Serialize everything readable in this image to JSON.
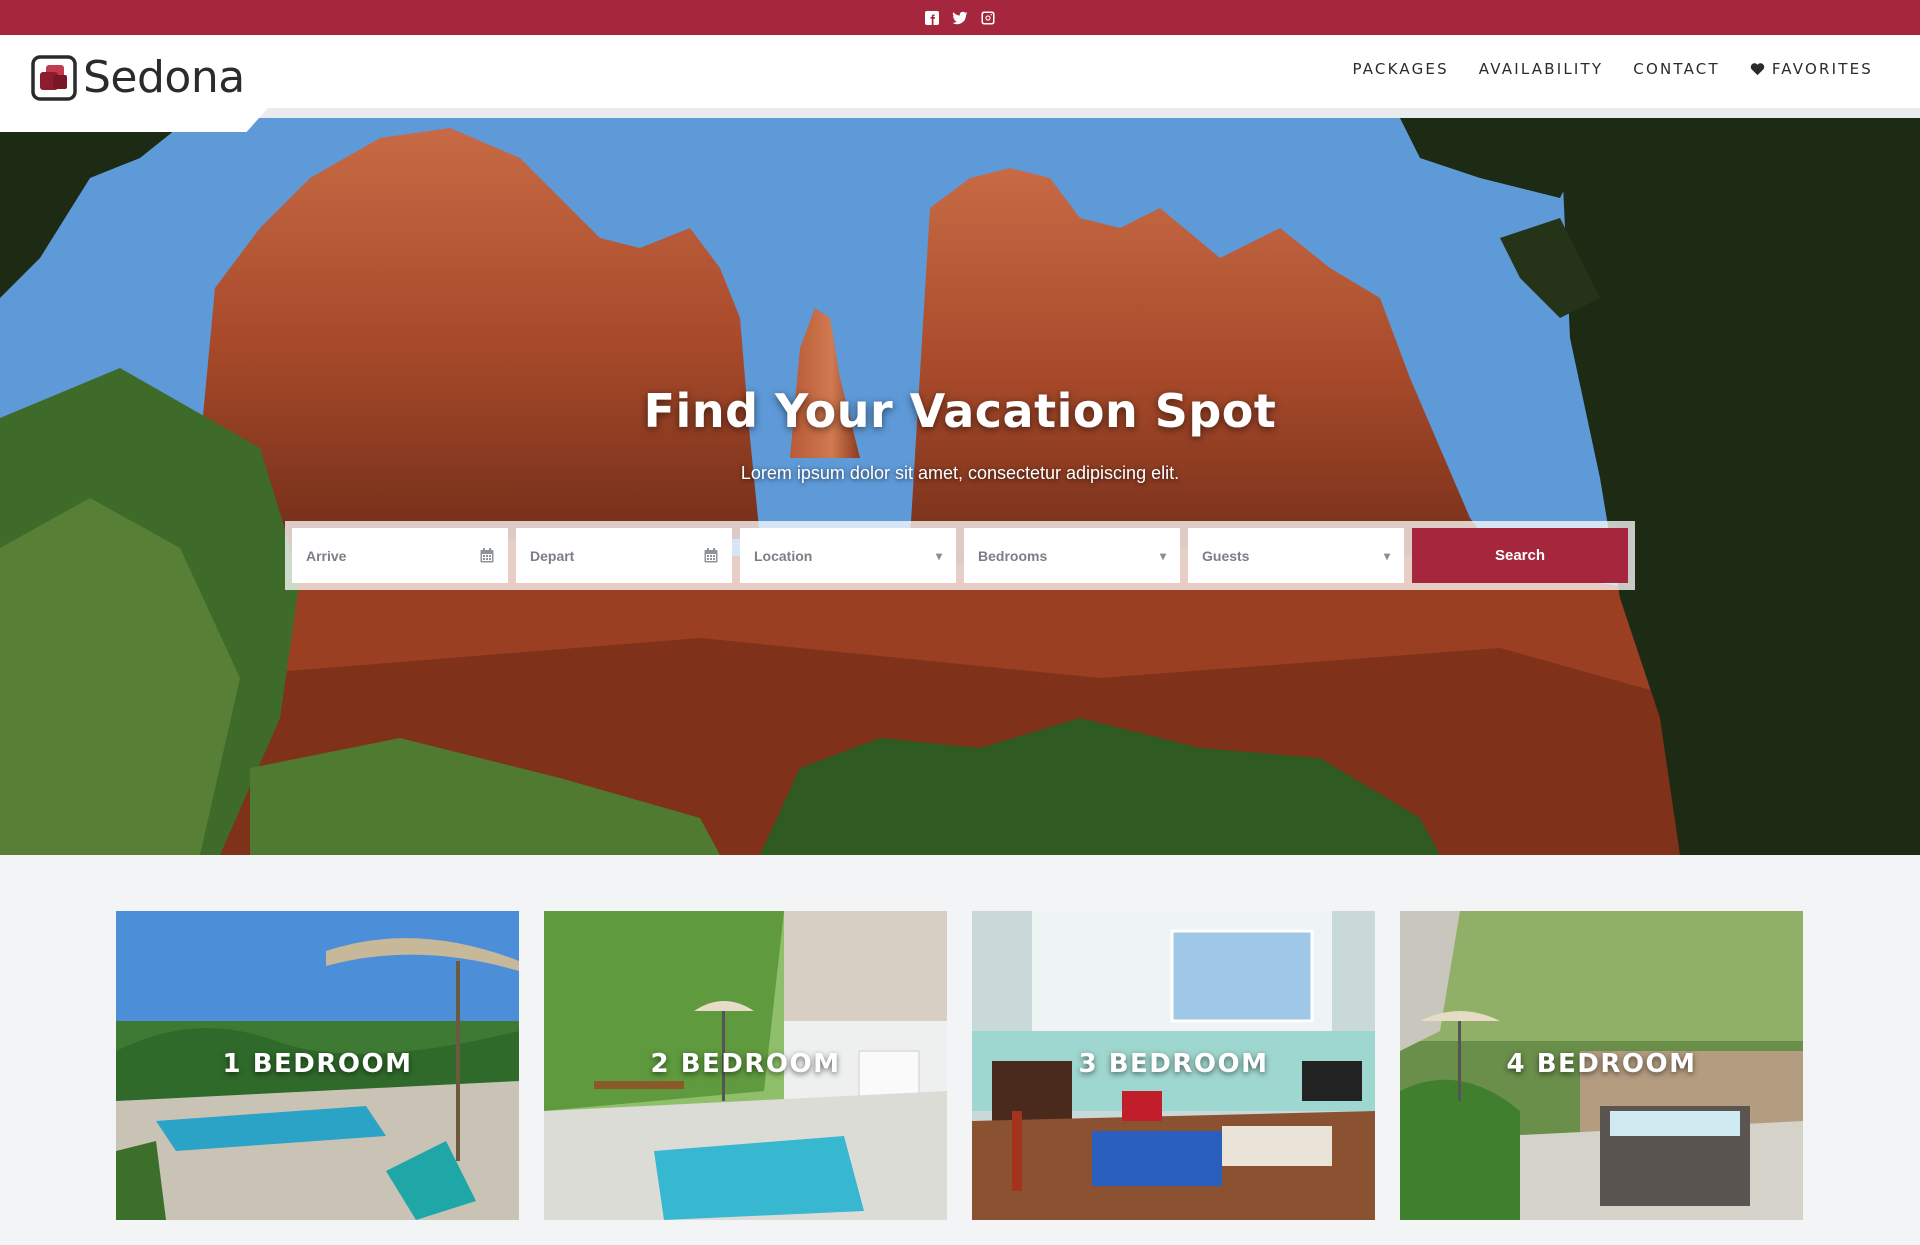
{
  "topbar": {
    "icons": [
      "facebook-icon",
      "twitter-icon",
      "instagram-icon"
    ],
    "background": "#a6263d"
  },
  "header": {
    "brand": "Sedona",
    "nav": {
      "packages": "PACKAGES",
      "availability": "AVAILABILITY",
      "contact": "CONTACT",
      "favorites": "FAVORITES"
    }
  },
  "hero": {
    "title": "Find Your Vacation Spot",
    "subtitle": "Lorem ipsum dolor sit amet, consectetur adipiscing elit."
  },
  "search": {
    "arrive": "Arrive",
    "depart": "Depart",
    "location": "Location",
    "bedrooms": "Bedrooms",
    "guests": "Guests",
    "button": "Search"
  },
  "cards": [
    {
      "label": "1 BEDROOM"
    },
    {
      "label": "2 BEDROOM"
    },
    {
      "label": "3 BEDROOM"
    },
    {
      "label": "4 BEDROOM"
    }
  ],
  "colors": {
    "accent": "#a6263d",
    "text": "#2b2b2b",
    "page_bg": "#f2f4f6"
  }
}
